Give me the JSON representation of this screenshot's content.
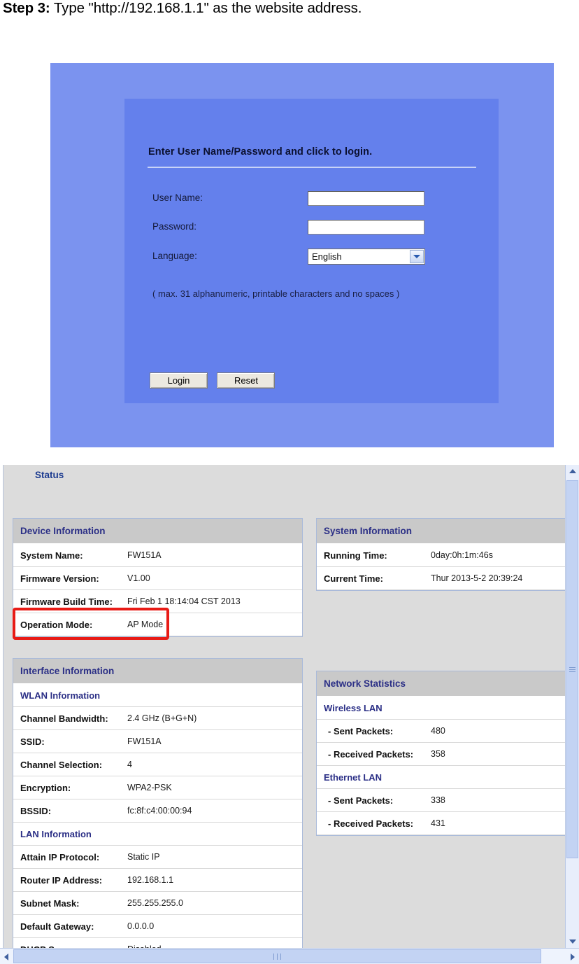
{
  "step": {
    "label": "Step 3:",
    "text": " Type \"http://192.168.1.1\" as the website address."
  },
  "login_page": {
    "title": "Enter User Name/Password and click to login.",
    "fields": {
      "username_label": "User Name:",
      "username_value": "",
      "password_label": "Password:",
      "password_value": "",
      "language_label": "Language:",
      "language_value": "English"
    },
    "hint": "( max. 31 alphanumeric, printable characters and no spaces )",
    "buttons": {
      "login": "Login",
      "reset": "Reset"
    },
    "colors": {
      "outer_background": "#7b93ef",
      "inner_panel": "#6480ec"
    }
  },
  "status_page": {
    "title": "Status",
    "highlight_color": "#e81b16",
    "device_information": {
      "heading": "Device Information",
      "rows": [
        {
          "key": "System Name:",
          "value": "FW151A"
        },
        {
          "key": "Firmware Version:",
          "value": "V1.00"
        },
        {
          "key": "Firmware Build Time:",
          "value": "Fri Feb 1 18:14:04 CST 2013"
        },
        {
          "key": "Operation Mode:",
          "value": "AP Mode"
        }
      ]
    },
    "system_information": {
      "heading": "System Information",
      "rows": [
        {
          "key": "Running Time:",
          "value": "0day:0h:1m:46s"
        },
        {
          "key": "Current Time:",
          "value": "Thur 2013-5-2 20:39:24"
        }
      ]
    },
    "interface_information": {
      "heading": "Interface Information",
      "wlan_heading": "WLAN Information",
      "wlan_rows": [
        {
          "key": "Channel Bandwidth:",
          "value": "2.4 GHz (B+G+N)"
        },
        {
          "key": "SSID:",
          "value": "FW151A"
        },
        {
          "key": "Channel Selection:",
          "value": "4"
        },
        {
          "key": "Encryption:",
          "value": "WPA2-PSK"
        },
        {
          "key": "BSSID:",
          "value": "fc:8f:c4:00:00:94"
        }
      ],
      "lan_heading": "LAN Information",
      "lan_rows": [
        {
          "key": "Attain IP Protocol:",
          "value": "Static IP"
        },
        {
          "key": "Router IP Address:",
          "value": "192.168.1.1"
        },
        {
          "key": "Subnet Mask:",
          "value": "255.255.255.0"
        },
        {
          "key": "Default Gateway:",
          "value": "0.0.0.0"
        },
        {
          "key": "DHCP Server:",
          "value": "Disabled"
        }
      ]
    },
    "network_statistics": {
      "heading": "Network Statistics",
      "wireless_heading": "Wireless LAN",
      "wireless_rows": [
        {
          "key": "- Sent Packets:",
          "value": "480"
        },
        {
          "key": "- Received Packets:",
          "value": "358"
        }
      ],
      "ethernet_heading": "Ethernet LAN",
      "ethernet_rows": [
        {
          "key": "- Sent Packets:",
          "value": "338"
        },
        {
          "key": "- Received Packets:",
          "value": "431"
        }
      ]
    }
  }
}
